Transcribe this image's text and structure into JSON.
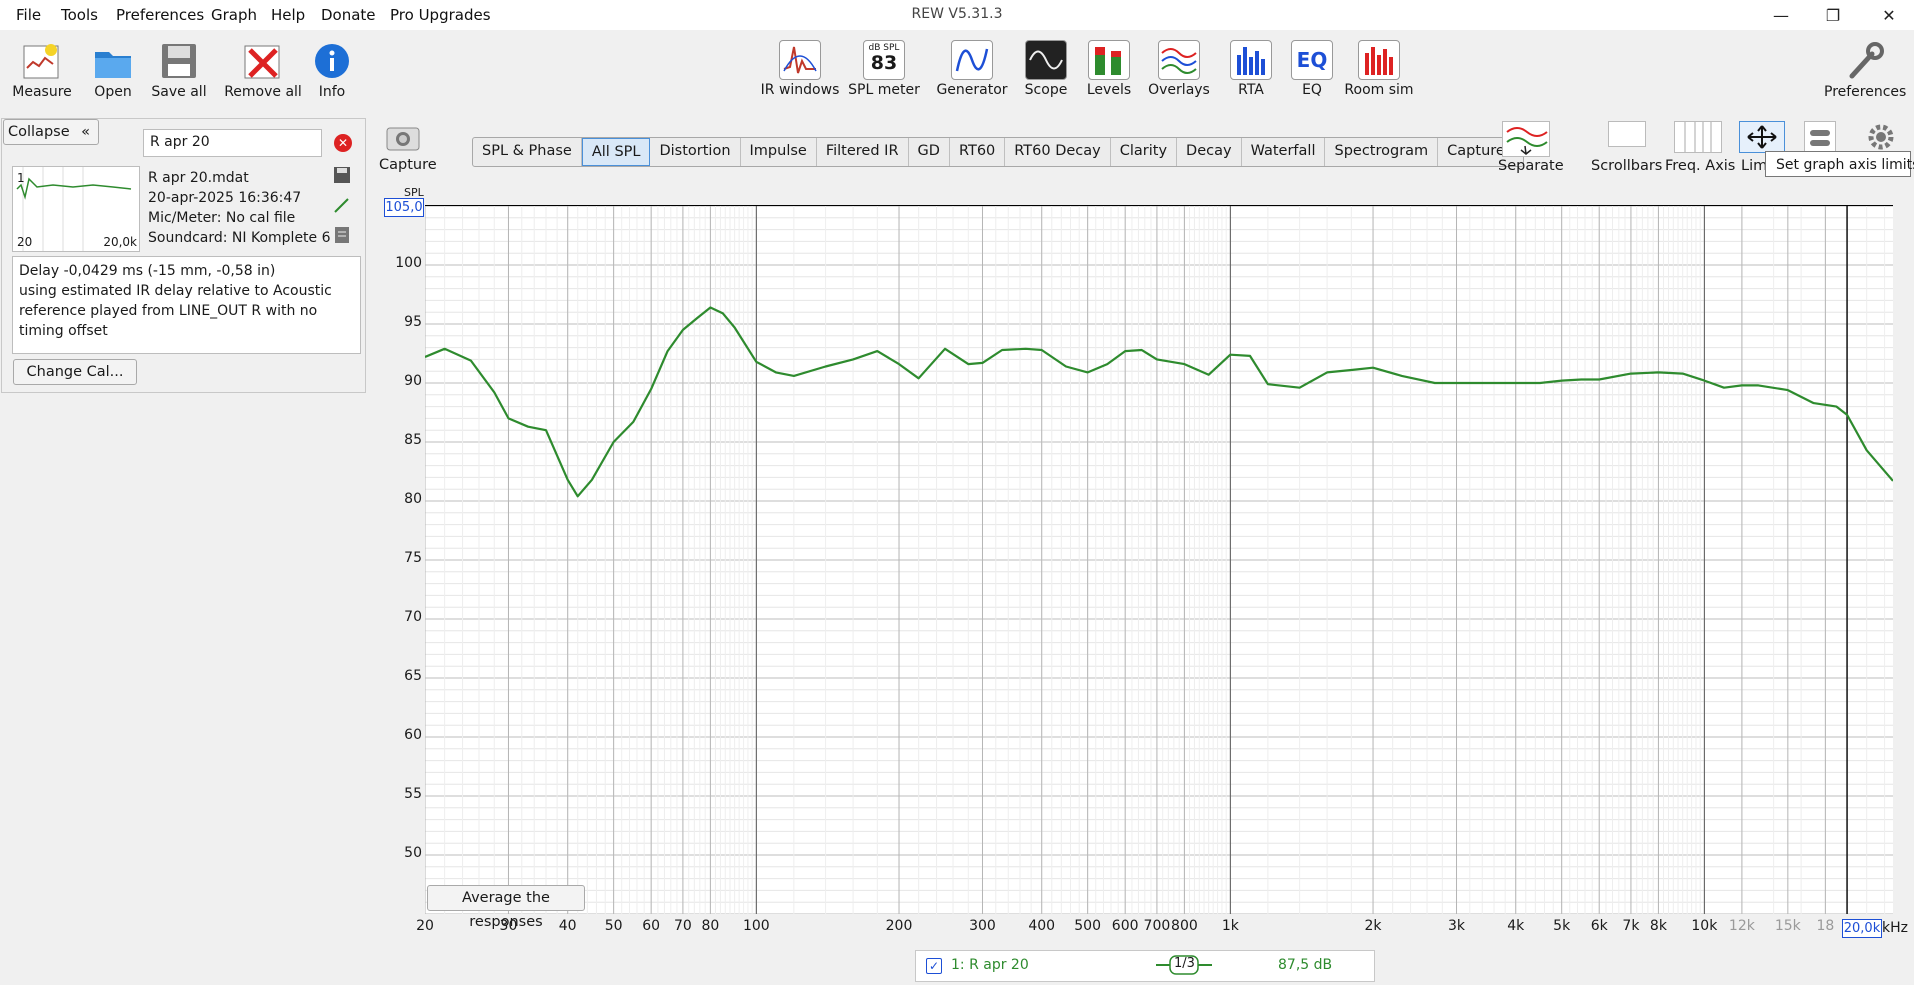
{
  "window": {
    "title": "REW V5.31.3"
  },
  "menu": [
    "File",
    "Tools",
    "Preferences",
    "Graph",
    "Help",
    "Donate",
    "Pro Upgrades"
  ],
  "toolbar_left": [
    {
      "label": "Measure",
      "icon": "measure-icon"
    },
    {
      "label": "Open",
      "icon": "folder-icon"
    },
    {
      "label": "Save all",
      "icon": "save-icon"
    },
    {
      "label": "Remove all",
      "icon": "remove-icon"
    },
    {
      "label": "Info",
      "icon": "info-icon"
    }
  ],
  "toolbar_center": [
    {
      "label": "IR windows",
      "icon": "ir-windows-icon"
    },
    {
      "label": "SPL meter",
      "icon": "spl-meter-icon",
      "badge_top": "dB SPL",
      "badge_value": "83"
    },
    {
      "label": "Generator",
      "icon": "generator-icon"
    },
    {
      "label": "Scope",
      "icon": "scope-icon"
    },
    {
      "label": "Levels",
      "icon": "levels-icon"
    },
    {
      "label": "Overlays",
      "icon": "overlays-icon"
    },
    {
      "label": "RTA",
      "icon": "rta-icon"
    },
    {
      "label": "EQ",
      "icon": "eq-icon"
    },
    {
      "label": "Room sim",
      "icon": "room-sim-icon"
    }
  ],
  "toolbar_right": {
    "label": "Preferences",
    "icon": "wrench-icon"
  },
  "left_panel": {
    "collapse_label": "Collapse",
    "measurement_name": "R apr 20",
    "file_name": "R apr 20.mdat",
    "date": "20-apr-2025 16:36:47",
    "mic": "Mic/Meter: No cal file",
    "soundcard": "Soundcard: NI Komplete 6",
    "thumb_index": "1",
    "thumb_x_start": "20",
    "thumb_x_end": "20,0k",
    "delay_text": "Delay -0,0429 ms (-15 mm, -0,58 in)",
    "delay_note": "using estimated IR delay relative to Acoustic reference played from LINE_OUT R with no timing offset",
    "change_cal_label": "Change Cal..."
  },
  "capture": {
    "label": "Capture"
  },
  "graph_tabs": [
    {
      "label": "SPL & Phase",
      "selected": false
    },
    {
      "label": "All SPL",
      "selected": true
    },
    {
      "label": "Distortion",
      "selected": false
    },
    {
      "label": "Impulse",
      "selected": false
    },
    {
      "label": "Filtered IR",
      "selected": false
    },
    {
      "label": "GD",
      "selected": false
    },
    {
      "label": "RT60",
      "selected": false
    },
    {
      "label": "RT60 Decay",
      "selected": false
    },
    {
      "label": "Clarity",
      "selected": false
    },
    {
      "label": "Decay",
      "selected": false
    },
    {
      "label": "Waterfall",
      "selected": false
    },
    {
      "label": "Spectrogram",
      "selected": false
    },
    {
      "label": "Captured",
      "selected": false
    }
  ],
  "graph_controls": {
    "separate": "Separate",
    "scrollbars": "Scrollbars",
    "freq_axis": "Freq. Axis",
    "limits": "Lim",
    "tooltip": "Set graph axis limits"
  },
  "average_button": "Average the responses",
  "legend": {
    "checked": true,
    "name": "1: R apr 20",
    "smoothing": "1/3",
    "level": "87,5 dB",
    "color": "#2e8b2e"
  },
  "chart_data": {
    "type": "line",
    "ylabel": "SPL",
    "xlabel": "kHz",
    "x_scale": "log",
    "xlim": [
      20,
      25000
    ],
    "ylim": [
      45,
      105
    ],
    "y_top_value_label": "105,0",
    "x_right_value_label": "20,0k",
    "grid": true,
    "y_ticks": [
      "100",
      "95",
      "90",
      "85",
      "80",
      "75",
      "70",
      "65",
      "60",
      "55",
      "50"
    ],
    "y_tick_values": [
      100,
      95,
      90,
      85,
      80,
      75,
      70,
      65,
      60,
      55,
      50
    ],
    "x_tick_values": [
      20,
      30,
      40,
      50,
      60,
      70,
      80,
      100,
      200,
      300,
      400,
      500,
      600,
      700,
      800,
      1000,
      2000,
      3000,
      4000,
      5000,
      6000,
      7000,
      8000,
      10000,
      12000,
      15000,
      18000
    ],
    "x_tick_labels": [
      "20",
      "30",
      "40",
      "50",
      "60",
      "70",
      "80",
      "100",
      "200",
      "300",
      "400",
      "500",
      "600",
      "700",
      "800",
      "1k",
      "2k",
      "3k",
      "4k",
      "5k",
      "6k",
      "7k",
      "8k",
      "10k",
      "12k",
      "15k",
      "18"
    ],
    "series": [
      {
        "name": "1: R apr 20",
        "color": "#2e8b2e",
        "x": [
          20,
          22,
          25,
          28,
          30,
          33,
          36,
          40,
          42,
          45,
          50,
          55,
          60,
          65,
          70,
          75,
          80,
          85,
          90,
          100,
          110,
          120,
          140,
          160,
          180,
          200,
          220,
          250,
          280,
          300,
          330,
          370,
          400,
          450,
          500,
          550,
          600,
          650,
          700,
          800,
          900,
          1000,
          1100,
          1200,
          1400,
          1600,
          1800,
          2000,
          2300,
          2700,
          3000,
          3500,
          4000,
          4500,
          5000,
          5500,
          6000,
          7000,
          8000,
          9000,
          10000,
          11000,
          12000,
          13000,
          15000,
          17000,
          19000,
          20000,
          22000,
          25000
        ],
        "y": [
          92.2,
          92.9,
          91.9,
          89.2,
          87.0,
          86.3,
          86.0,
          81.8,
          80.4,
          81.8,
          85.0,
          86.7,
          89.5,
          92.7,
          94.5,
          95.5,
          96.4,
          95.9,
          94.7,
          91.8,
          90.9,
          90.6,
          91.4,
          92.0,
          92.7,
          91.6,
          90.4,
          92.9,
          91.6,
          91.7,
          92.8,
          92.9,
          92.8,
          91.4,
          90.9,
          91.6,
          92.7,
          92.8,
          92.0,
          91.6,
          90.7,
          92.4,
          92.3,
          89.9,
          89.6,
          90.9,
          91.1,
          91.3,
          90.6,
          90.0,
          90.0,
          90.0,
          90.0,
          90.0,
          90.2,
          90.3,
          90.3,
          90.8,
          90.9,
          90.8,
          90.2,
          89.6,
          89.8,
          89.8,
          89.4,
          88.3,
          88.0,
          87.3,
          84.3,
          81.7
        ]
      }
    ]
  }
}
